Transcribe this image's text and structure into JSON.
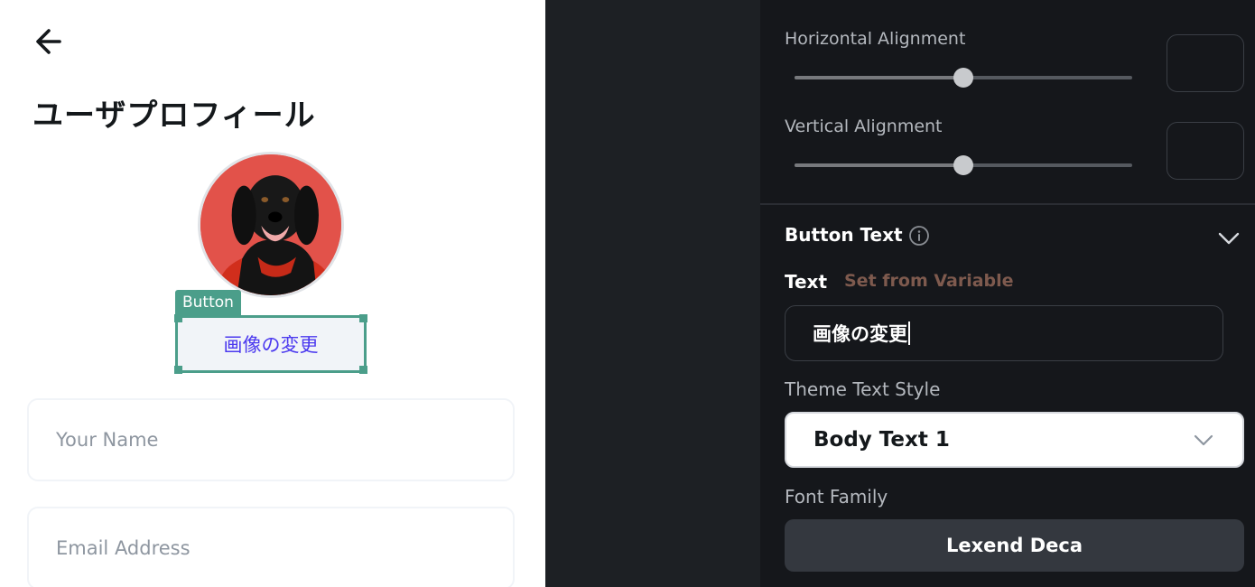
{
  "preview": {
    "title": "ユーザプロフィール",
    "selection_tag": "Button",
    "change_image_button": "画像の変更",
    "name_placeholder": "Your Name",
    "email_placeholder": "Email Address",
    "icons": {
      "back": "arrow-left-icon"
    }
  },
  "panel": {
    "horizontal_alignment": {
      "label": "Horizontal Alignment",
      "value": 0.5
    },
    "vertical_alignment": {
      "label": "Vertical Alignment",
      "value": 0.5
    },
    "button_text_section": {
      "title": "Button Text",
      "icons": {
        "info": "info-icon",
        "collapse": "chevron-down-icon"
      }
    },
    "text": {
      "label": "Text",
      "set_from_variable": "Set from Variable",
      "value": "画像の変更"
    },
    "theme_text_style": {
      "label": "Theme Text Style",
      "value": "Body Text 1"
    },
    "font_family": {
      "label": "Font Family",
      "value": "Lexend Deca"
    }
  },
  "colors": {
    "selection_accent": "#4b9e8a",
    "button_text": "#4b39ef",
    "panel_bg": "#15171b",
    "set_from_variable": "#7e5a4e"
  }
}
